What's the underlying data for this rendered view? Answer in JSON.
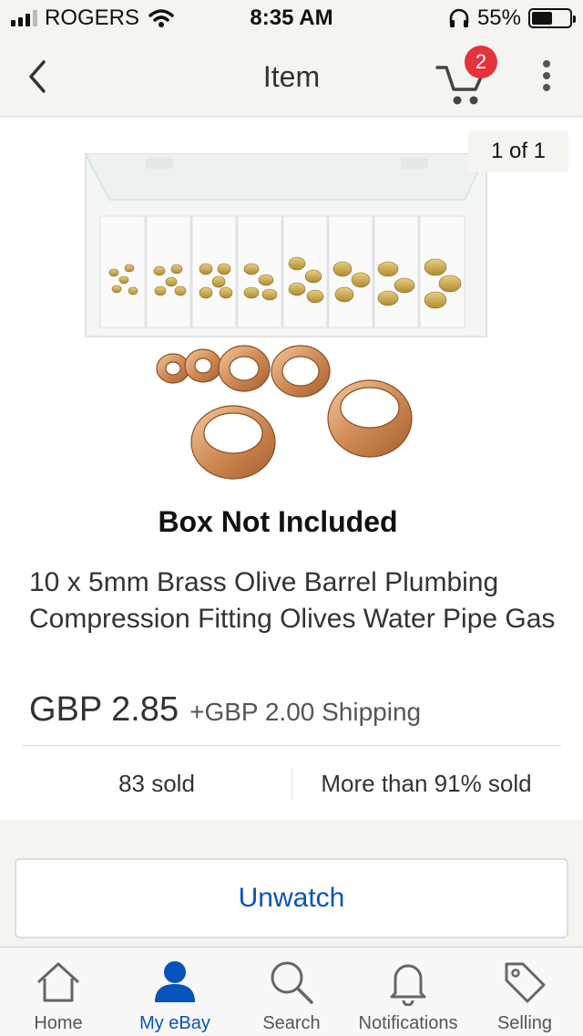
{
  "status_bar": {
    "carrier": "ROGERS",
    "time": "8:35 AM",
    "battery_percent": "55%",
    "battery_level": 0.55
  },
  "nav": {
    "back_icon": "chevron-left-icon",
    "title": "Item",
    "cart_icon": "cart-icon",
    "cart_count": "2",
    "menu_icon": "more-vertical-icon"
  },
  "gallery": {
    "pager": "1 of 1",
    "image_caption": "Box Not Included"
  },
  "product": {
    "title": "10 x 5mm Brass Olive Barrel Plumbing Compression Fitting Olives Water Pipe Gas",
    "price": "GBP 2.85",
    "shipping": "+GBP 2.00 Shipping",
    "sold_count": "83 sold",
    "sold_rate": "More than 91% sold"
  },
  "actions": {
    "unwatch_label": "Unwatch"
  },
  "colors": {
    "accent_blue": "#0654ba",
    "badge_red": "#e5323b",
    "background": "#f5f4f0"
  },
  "tab_bar": {
    "tabs": [
      {
        "label": "Home",
        "icon": "home-icon",
        "active": false
      },
      {
        "label": "My eBay",
        "icon": "user-icon",
        "active": true
      },
      {
        "label": "Search",
        "icon": "search-icon",
        "active": false
      },
      {
        "label": "Notifications",
        "icon": "bell-icon",
        "active": false
      },
      {
        "label": "Selling",
        "icon": "tag-icon",
        "active": false
      }
    ]
  }
}
